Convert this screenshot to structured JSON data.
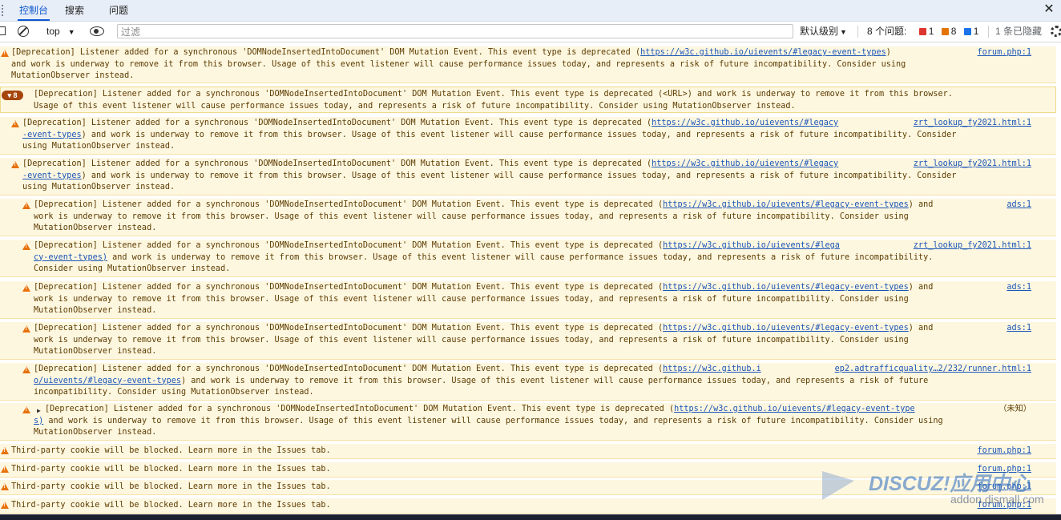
{
  "tabs": [
    {
      "label": "控制台",
      "active": true
    },
    {
      "label": "搜索",
      "active": false
    },
    {
      "label": "问题",
      "active": false
    }
  ],
  "toolbar": {
    "context": "top",
    "filter_placeholder": "过滤",
    "level": "默认级别",
    "issues_label": "8 个问题:",
    "issue_errors": "1",
    "issue_warnings": "8",
    "issue_info": "1",
    "hidden": "1 条已隐藏"
  },
  "messages": [
    {
      "lines": [
        "[Deprecation] Listener added for a synchronous 'DOMNodeInsertedIntoDocument' DOM Mutation Event. This event type is deprecated (",
        "and work is underway to remove it from this browser. Usage of this event listener will cause performance issues today, and represents a risk of future incompatibility. Consider using",
        "MutationObserver instead."
      ],
      "link": "https://w3c.github.io/uievents/#legacy-event-types",
      "link_tail": ")",
      "source": "forum.php:1"
    },
    {
      "count": "8",
      "lines": [
        "[Deprecation] Listener added for a synchronous 'DOMNodeInsertedIntoDocument' DOM Mutation Event. This event type is deprecated (<URL>) and work is underway to remove it from this browser.",
        "Usage of this event listener will cause performance issues today, and represents a risk of future incompatibility. Consider using MutationObserver instead."
      ]
    },
    {
      "lines": [
        "[Deprecation] Listener added for a synchronous 'DOMNodeInsertedIntoDocument' DOM Mutation Event. This event type is deprecated (",
        ") and work is underway to remove it from this browser. Usage of this event listener will cause performance issues today, and represents a risk of future incompatibility. Consider",
        "using MutationObserver instead."
      ],
      "link": "https://w3c.github.io/uievents/#legacy",
      "link2": "-event-types",
      "source": "zrt_lookup_fy2021.html:1"
    },
    {
      "lines": [
        "[Deprecation] Listener added for a synchronous 'DOMNodeInsertedIntoDocument' DOM Mutation Event. This event type is deprecated (",
        ") and work is underway to remove it from this browser. Usage of this event listener will cause performance issues today, and represents a risk of future incompatibility. Consider",
        "using MutationObserver instead."
      ],
      "link": "https://w3c.github.io/uievents/#legacy",
      "link2": "-event-types",
      "source": "zrt_lookup_fy2021.html:1"
    },
    {
      "lines": [
        "[Deprecation] Listener added for a synchronous 'DOMNodeInsertedIntoDocument' DOM Mutation Event. This event type is deprecated (",
        "work is underway to remove it from this browser. Usage of this event listener will cause performance issues today, and represents a risk of future incompatibility. Consider using",
        "MutationObserver instead."
      ],
      "link": "https://w3c.github.io/uievents/#legacy-event-types",
      "link_tail": ") and",
      "source": "ads:1"
    },
    {
      "lines": [
        "[Deprecation] Listener added for a synchronous 'DOMNodeInsertedIntoDocument' DOM Mutation Event. This event type is deprecated (",
        " and work is underway to remove it from this browser. Usage of this event listener will cause performance issues today, and represents a risk of future incompatibility.",
        "Consider using MutationObserver instead."
      ],
      "link": "https://w3c.github.io/uievents/#lega",
      "link2": "cy-event-types)",
      "source": "zrt_lookup_fy2021.html:1"
    },
    {
      "lines": [
        "[Deprecation] Listener added for a synchronous 'DOMNodeInsertedIntoDocument' DOM Mutation Event. This event type is deprecated (",
        "work is underway to remove it from this browser. Usage of this event listener will cause performance issues today, and represents a risk of future incompatibility. Consider using",
        "MutationObserver instead."
      ],
      "link": "https://w3c.github.io/uievents/#legacy-event-types",
      "link_tail": ") and",
      "source": "ads:1"
    },
    {
      "lines": [
        "[Deprecation] Listener added for a synchronous 'DOMNodeInsertedIntoDocument' DOM Mutation Event. This event type is deprecated (",
        "work is underway to remove it from this browser. Usage of this event listener will cause performance issues today, and represents a risk of future incompatibility. Consider using",
        "MutationObserver instead."
      ],
      "link": "https://w3c.github.io/uievents/#legacy-event-types",
      "link_tail": ") and",
      "source": "ads:1"
    },
    {
      "lines": [
        "[Deprecation] Listener added for a synchronous 'DOMNodeInsertedIntoDocument' DOM Mutation Event. This event type is deprecated (",
        ") and work is underway to remove it from this browser. Usage of this event listener will cause performance issues today, and represents a risk of future",
        "incompatibility. Consider using MutationObserver instead."
      ],
      "link": "https://w3c.github.i",
      "link2": "o/uievents/#legacy-event-types",
      "source": "ep2.adtrafficquality…2/232/runner.html:1"
    },
    {
      "lines": [
        "[Deprecation] Listener added for a synchronous 'DOMNodeInsertedIntoDocument' DOM Mutation Event. This event type is deprecated (",
        " and work is underway to remove it from this browser. Usage of this event listener will cause performance issues today, and represents a risk of future incompatibility. Consider using",
        "MutationObserver instead."
      ],
      "link": "https://w3c.github.io/uievents/#legacy-event-type",
      "link2": "s)",
      "source": "（未知）"
    }
  ],
  "cookie_messages": [
    {
      "text": "Third-party cookie will be blocked. Learn more in the Issues tab.",
      "source": "forum.php:1"
    },
    {
      "text": "Third-party cookie will be blocked. Learn more in the Issues tab.",
      "source": "forum.php:1"
    },
    {
      "text": "Third-party cookie will be blocked. Learn more in the Issues tab.",
      "source": "forum.php:1"
    },
    {
      "text": "Third-party cookie will be blocked. Learn more in the Issues tab.",
      "source": "forum.php:1"
    }
  ],
  "watermark": {
    "title": "DISCUZ!应用中心",
    "sub": "addon.dismall.com"
  }
}
